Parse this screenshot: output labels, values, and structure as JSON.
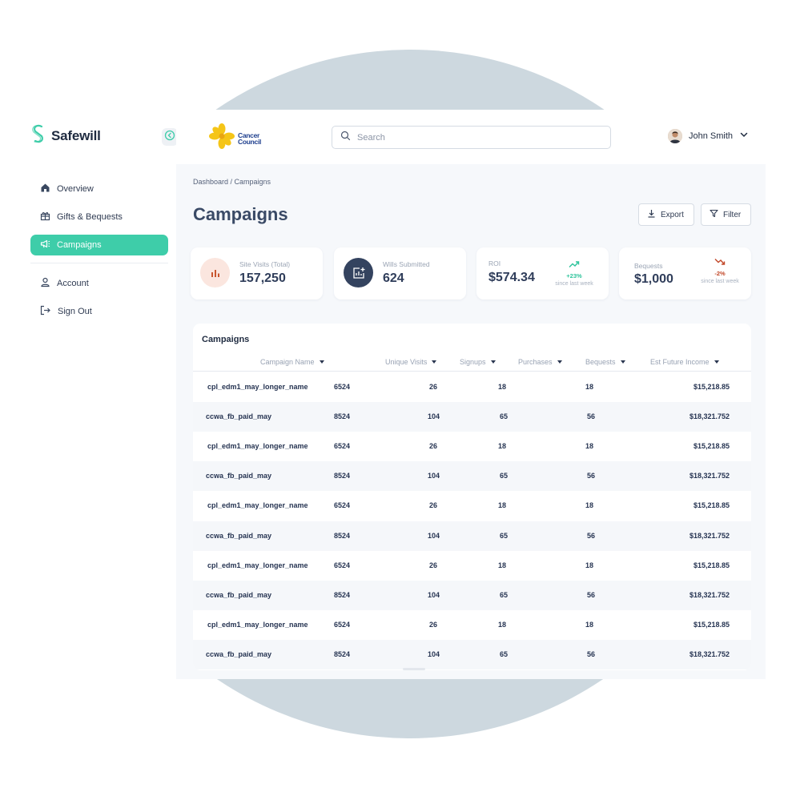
{
  "brand": {
    "name": "Safewill"
  },
  "org": {
    "line1": "Cancer",
    "line2": "Council"
  },
  "search": {
    "placeholder": "Search"
  },
  "user": {
    "name": "John Smith"
  },
  "sidebar": {
    "items": [
      {
        "label": "Overview",
        "icon": "home-icon"
      },
      {
        "label": "Gifts & Bequests",
        "icon": "gift-icon"
      },
      {
        "label": "Campaigns",
        "icon": "megaphone-icon",
        "active": true
      },
      {
        "label": "Account",
        "icon": "user-icon"
      },
      {
        "label": "Sign Out",
        "icon": "sign-out-icon"
      }
    ]
  },
  "breadcrumb": "Dashboard / Campaigns",
  "page_title": "Campaigns",
  "actions": {
    "export": "Export",
    "filter": "Filter"
  },
  "stats": [
    {
      "label": "Site Visits (Total)",
      "value": "157,250"
    },
    {
      "label": "Wills Submitted",
      "value": "624"
    },
    {
      "label": "ROI",
      "value": "$574.34",
      "trend": "+23%",
      "since": "since last week",
      "direction": "up",
      "color": "#2fc49c"
    },
    {
      "label": "Bequests",
      "value": "$1,000",
      "trend": "-2%",
      "since": "since last week",
      "direction": "down",
      "color": "#c2492a"
    }
  ],
  "table": {
    "title": "Campaigns",
    "columns": [
      "Campaign Name",
      "Unique Visits",
      "Signups",
      "Purchases",
      "Bequests",
      "Est Future Income"
    ],
    "rows": [
      [
        "cpl_edm1_may_longer_name",
        "6524",
        "26",
        "18",
        "18",
        "$15,218.85"
      ],
      [
        "ccwa_fb_paid_may",
        "8524",
        "104",
        "65",
        "56",
        "$18,321.752"
      ],
      [
        "cpl_edm1_may_longer_name",
        "6524",
        "26",
        "18",
        "18",
        "$15,218.85"
      ],
      [
        "ccwa_fb_paid_may",
        "8524",
        "104",
        "65",
        "56",
        "$18,321.752"
      ],
      [
        "cpl_edm1_may_longer_name",
        "6524",
        "26",
        "18",
        "18",
        "$15,218.85"
      ],
      [
        "ccwa_fb_paid_may",
        "8524",
        "104",
        "65",
        "56",
        "$18,321.752"
      ],
      [
        "cpl_edm1_may_longer_name",
        "6524",
        "26",
        "18",
        "18",
        "$15,218.85"
      ],
      [
        "ccwa_fb_paid_may",
        "8524",
        "104",
        "65",
        "56",
        "$18,321.752"
      ],
      [
        "cpl_edm1_may_longer_name",
        "6524",
        "26",
        "18",
        "18",
        "$15,218.85"
      ],
      [
        "ccwa_fb_paid_may",
        "8524",
        "104",
        "65",
        "56",
        "$18,321.752"
      ]
    ]
  },
  "colors": {
    "accent": "#3ecda9",
    "title": "#3a4a66",
    "circle": "#cdd8df"
  }
}
